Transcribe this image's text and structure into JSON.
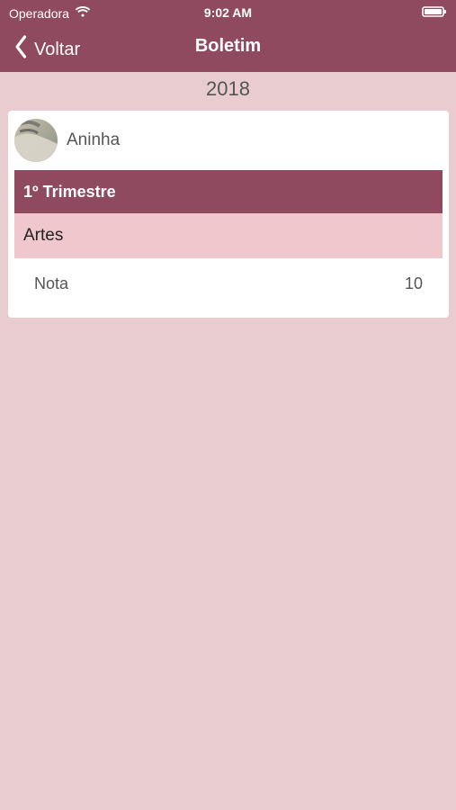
{
  "status_bar": {
    "carrier": "Operadora",
    "time": "9:02 AM",
    "wifi_icon": "wifi-icon",
    "battery_icon": "battery-icon"
  },
  "nav": {
    "back_label": "Voltar",
    "title": "Boletim",
    "back_icon": "chevron-left-icon"
  },
  "year": "2018",
  "student": {
    "name": "Aninha",
    "avatar_icon": "avatar-image"
  },
  "trimester": {
    "label": "1º Trimestre"
  },
  "subject": {
    "name": "Artes",
    "grade_label": "Nota",
    "grade_value": "10"
  },
  "colors": {
    "primary": "#8f4a60",
    "background": "#e9cccf",
    "subject_row": "#efc7cc",
    "card": "#ffffff"
  }
}
